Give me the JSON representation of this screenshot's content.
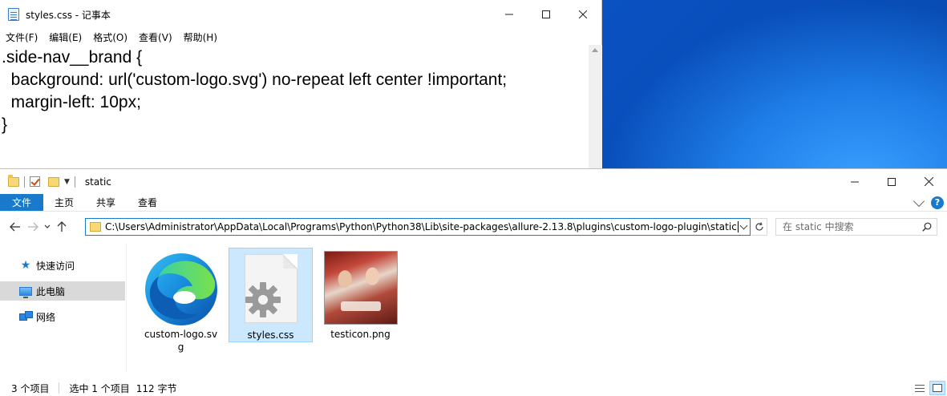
{
  "notepad": {
    "title": "styles.css - 记事本",
    "menu": [
      "文件(F)",
      "编辑(E)",
      "格式(O)",
      "查看(V)",
      "帮助(H)"
    ],
    "lines": [
      ".side-nav__brand {",
      "  background: url('custom-logo.svg') no-repeat left center !important;",
      "  margin-left: 10px;",
      "}"
    ]
  },
  "explorer": {
    "title": "static",
    "ribbon": {
      "file_tab": "文件",
      "tabs": [
        "主页",
        "共享",
        "查看"
      ]
    },
    "address": "C:\\Users\\Administrator\\AppData\\Local\\Programs\\Python\\Python38\\Lib\\site-packages\\allure-2.13.8\\plugins\\custom-logo-plugin\\static",
    "search_placeholder": "在 static 中搜索",
    "nav": [
      {
        "label": "快速访问",
        "icon": "star-icon"
      },
      {
        "label": "此电脑",
        "icon": "computer-icon",
        "selected": true
      },
      {
        "label": "网络",
        "icon": "network-icon"
      }
    ],
    "files": [
      {
        "name": "custom-logo.svg",
        "icon": "edge-icon"
      },
      {
        "name": "styles.css",
        "icon": "css-file-icon",
        "selected": true
      },
      {
        "name": "testicon.png",
        "icon": "image-thumbnail"
      }
    ],
    "status": {
      "count": "3 个项目",
      "selected": "选中 1 个项目",
      "size": "112 字节"
    }
  },
  "colors": {
    "accent": "#1979ca",
    "selection": "#cce8ff",
    "desktop": "#0a52c4"
  }
}
